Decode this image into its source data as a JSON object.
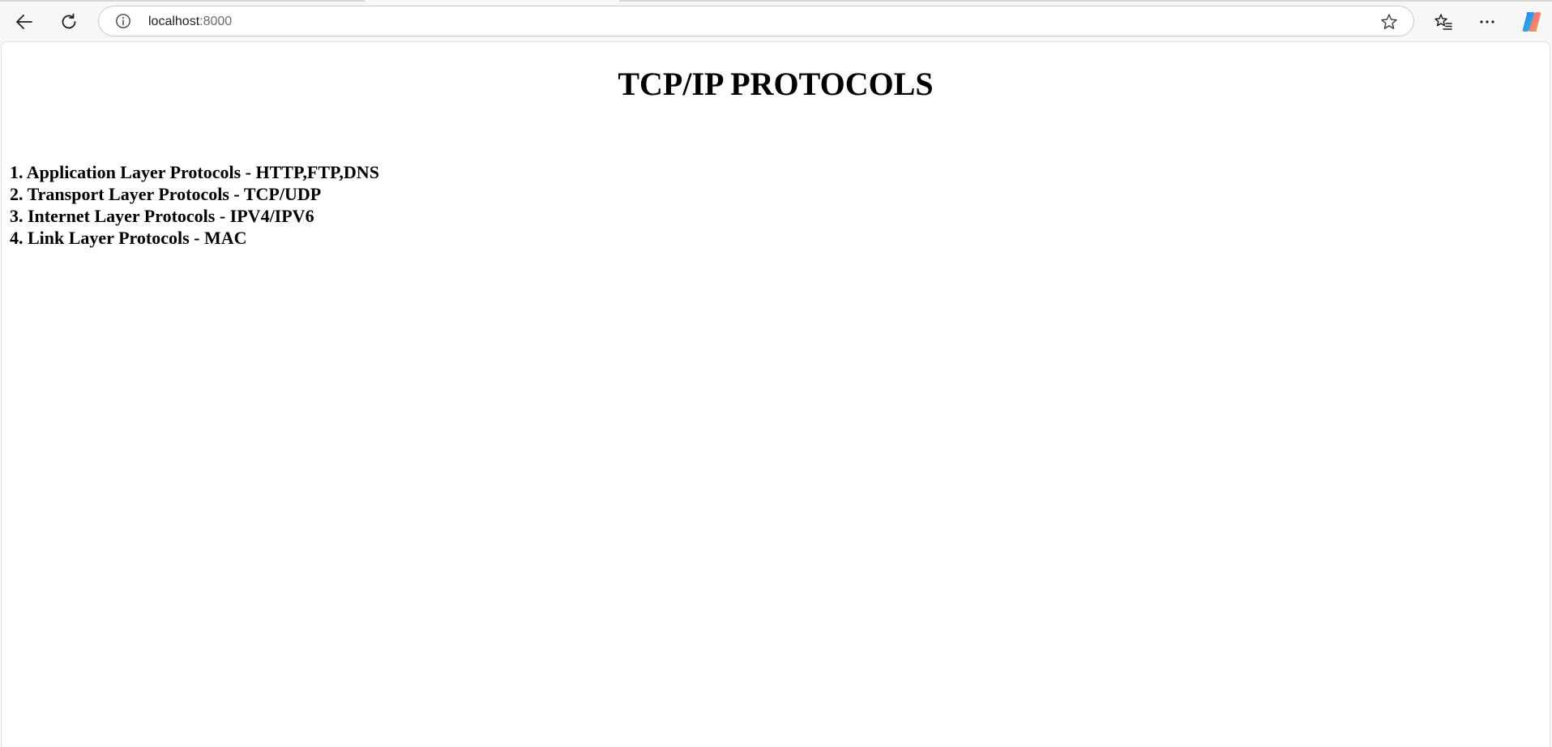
{
  "browser": {
    "url_host": "localhost",
    "url_port": ":8000",
    "icons": {
      "back": "back-arrow-icon",
      "refresh": "refresh-icon",
      "info": "info-icon",
      "favorite": "star-icon",
      "favorites_list": "favorites-list-icon",
      "more": "more-options-icon",
      "copilot": "copilot-icon"
    }
  },
  "page": {
    "title": "TCP/IP PROTOCOLS",
    "items": [
      "1. Application Layer Protocols - HTTP,FTP,DNS",
      "2. Transport Layer Protocols - TCP/UDP",
      "3. Internet Layer Protocols - IPV4/IPV6",
      "4. Link Layer Protocols - MAC"
    ]
  }
}
